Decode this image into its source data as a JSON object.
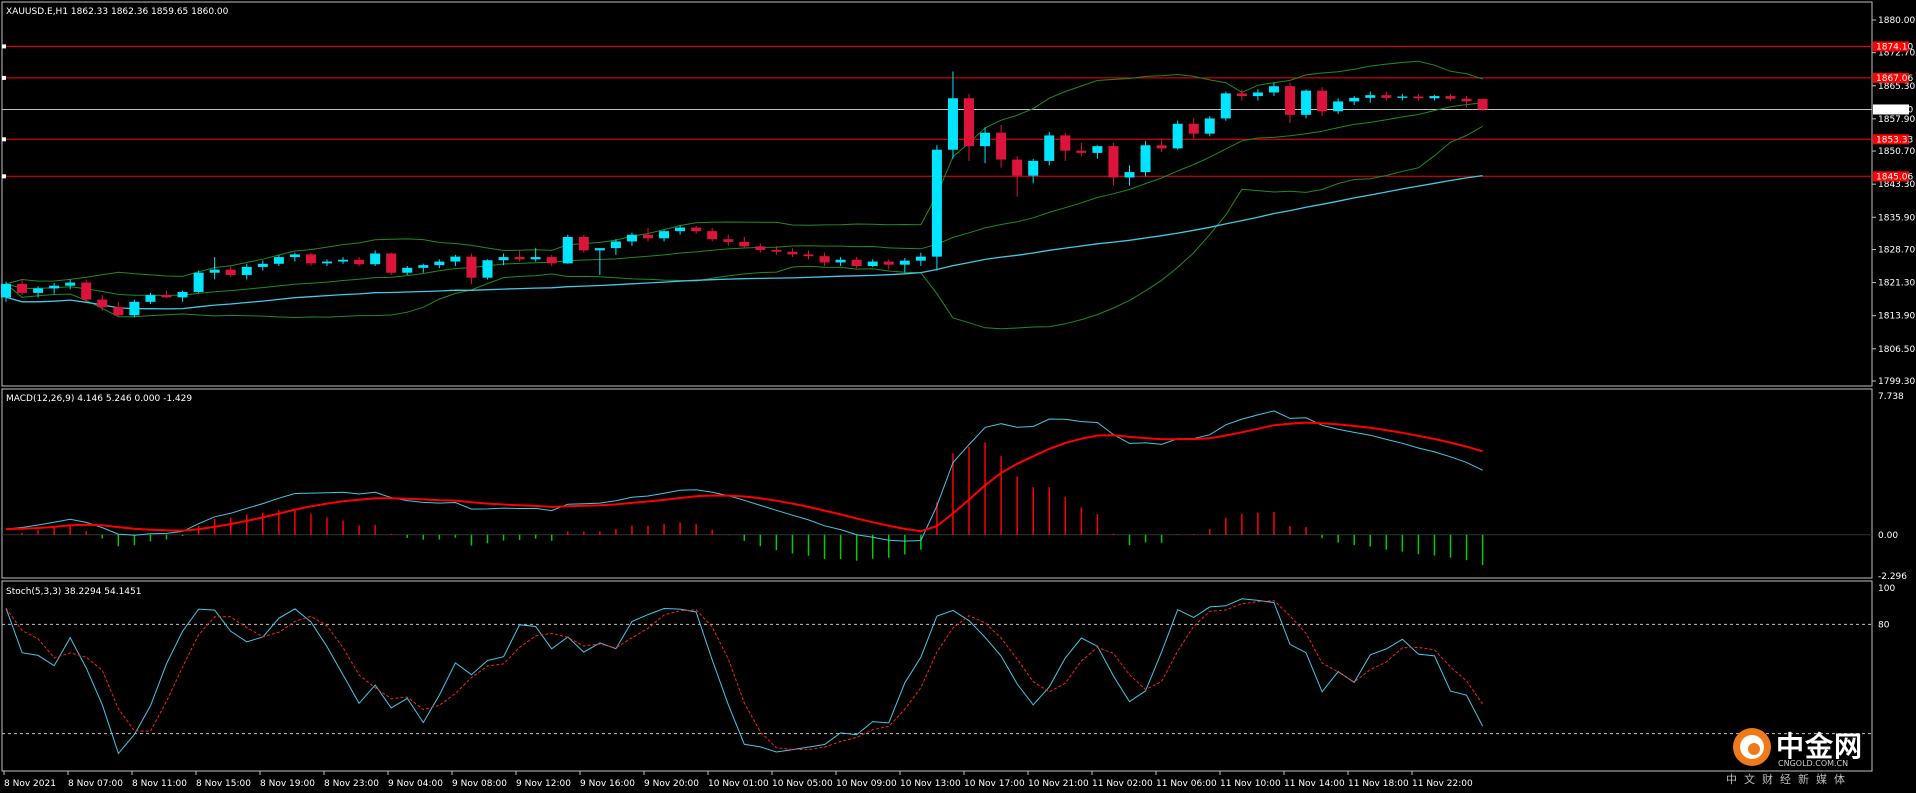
{
  "colors": {
    "background": "#000000",
    "frame": "#c0c0c0",
    "bull_candle": "#00e5ff",
    "bear_candle": "#dc143c",
    "hline": "#ff0000",
    "bid_line": "#c0c0c0",
    "bollinger": "#1e8c1e",
    "moving_average": "#41c8e6",
    "macd_line": "#41c8e6",
    "signal_line": "#ff0000",
    "hist_pos": "#ff0000",
    "hist_neg": "#00cc00",
    "stoch_main": "#41c8e6",
    "stoch_signal": "#ff2020",
    "level_line": "#c0c0c0"
  },
  "main_panel": {
    "info": "XAUUSD.E,H1  1862.33 1862.36 1859.65 1860.00"
  },
  "macd_panel": {
    "info": "MACD(12,26,9) 4.146 5.246 0.000 -1.429"
  },
  "stoch_panel": {
    "info": "Stoch(5,3,3) 38.2294 54.1451"
  },
  "watermark": {
    "name": "中金网",
    "domain": "CNGOLD.COM.CN",
    "tagline": "中文财经新媒体"
  },
  "chart_data": [
    {
      "type": "candlestick",
      "title": "XAUUSD.E,H1",
      "y_ticks": [
        "1880.00",
        "1872.70",
        "1865.30",
        "1857.90",
        "1850.70",
        "1843.30",
        "1835.90",
        "1828.70",
        "1821.30",
        "1813.90",
        "1806.50",
        "1799.30"
      ],
      "ylim": [
        1799.3,
        1880.0
      ],
      "price_badges": [
        {
          "label": "1874.10",
          "value": 1874.1
        },
        {
          "label": "1867.06",
          "value": 1867.06
        },
        {
          "label": "1853.33",
          "value": 1853.33
        },
        {
          "label": "1845.06",
          "value": 1845.06
        }
      ],
      "bid": {
        "label": "1860.00",
        "value": 1860.0
      },
      "horizontal_lines": [
        1874.1,
        1867.06,
        1853.33,
        1845.06
      ],
      "ohlc": [
        [
          1818.0,
          1821.5,
          1817.0,
          1821.0
        ],
        [
          1821.0,
          1822.0,
          1818.5,
          1819.0
        ],
        [
          1819.0,
          1820.5,
          1818.0,
          1820.0
        ],
        [
          1820.0,
          1821.2,
          1818.8,
          1820.6
        ],
        [
          1820.6,
          1822.0,
          1819.8,
          1821.3
        ],
        [
          1821.3,
          1822.0,
          1817.0,
          1817.5
        ],
        [
          1817.5,
          1818.5,
          1815.0,
          1815.8
        ],
        [
          1815.8,
          1817.0,
          1813.5,
          1814.0
        ],
        [
          1814.0,
          1817.5,
          1813.5,
          1817.0
        ],
        [
          1817.0,
          1819.0,
          1816.5,
          1818.5
        ],
        [
          1818.5,
          1819.5,
          1817.8,
          1818.0
        ],
        [
          1818.0,
          1819.5,
          1817.0,
          1819.2
        ],
        [
          1819.2,
          1824.0,
          1819.0,
          1823.5
        ],
        [
          1823.5,
          1827.0,
          1822.0,
          1824.2
        ],
        [
          1824.2,
          1825.0,
          1822.5,
          1823.0
        ],
        [
          1823.0,
          1825.5,
          1822.0,
          1824.8
        ],
        [
          1824.8,
          1826.2,
          1824.0,
          1825.5
        ],
        [
          1825.5,
          1827.5,
          1825.0,
          1827.0
        ],
        [
          1827.0,
          1828.0,
          1826.0,
          1827.6
        ],
        [
          1827.6,
          1828.0,
          1825.0,
          1825.6
        ],
        [
          1825.6,
          1826.5,
          1825.0,
          1826.0
        ],
        [
          1826.0,
          1827.0,
          1825.5,
          1826.4
        ],
        [
          1826.4,
          1827.0,
          1825.0,
          1825.4
        ],
        [
          1825.4,
          1828.5,
          1825.0,
          1827.8
        ],
        [
          1827.8,
          1828.0,
          1823.0,
          1823.5
        ],
        [
          1823.5,
          1825.0,
          1823.0,
          1824.6
        ],
        [
          1824.6,
          1825.5,
          1823.5,
          1825.2
        ],
        [
          1825.2,
          1826.5,
          1824.5,
          1826.0
        ],
        [
          1826.0,
          1827.5,
          1825.0,
          1827.1
        ],
        [
          1827.1,
          1827.8,
          1821.0,
          1822.4
        ],
        [
          1822.4,
          1826.5,
          1822.0,
          1826.3
        ],
        [
          1826.3,
          1827.8,
          1825.2,
          1827.0
        ],
        [
          1827.0,
          1828.5,
          1826.0,
          1826.5
        ],
        [
          1826.5,
          1829.0,
          1826.0,
          1827.0
        ],
        [
          1827.0,
          1827.5,
          1825.0,
          1825.6
        ],
        [
          1825.6,
          1832.0,
          1825.5,
          1831.5
        ],
        [
          1831.5,
          1832.0,
          1828.0,
          1828.5
        ],
        [
          1828.5,
          1829.0,
          1823.0,
          1829.0
        ],
        [
          1829.0,
          1831.0,
          1827.5,
          1830.5
        ],
        [
          1830.5,
          1832.5,
          1829.5,
          1832.0
        ],
        [
          1832.0,
          1833.5,
          1830.5,
          1831.2
        ],
        [
          1831.2,
          1833.0,
          1830.5,
          1832.8
        ],
        [
          1832.8,
          1834.0,
          1832.0,
          1833.6
        ],
        [
          1833.6,
          1834.0,
          1832.2,
          1832.8
        ],
        [
          1832.8,
          1833.5,
          1830.5,
          1831.0
        ],
        [
          1831.0,
          1832.0,
          1829.5,
          1830.4
        ],
        [
          1830.4,
          1831.5,
          1829.0,
          1829.4
        ],
        [
          1829.4,
          1830.0,
          1828.0,
          1828.6
        ],
        [
          1828.6,
          1829.5,
          1827.5,
          1828.2
        ],
        [
          1828.2,
          1829.0,
          1827.0,
          1827.6
        ],
        [
          1827.6,
          1828.5,
          1826.5,
          1827.2
        ],
        [
          1827.2,
          1828.0,
          1825.0,
          1825.8
        ],
        [
          1825.8,
          1827.0,
          1825.0,
          1826.4
        ],
        [
          1826.4,
          1827.0,
          1824.5,
          1825.0
        ],
        [
          1825.0,
          1826.5,
          1824.8,
          1826.0
        ],
        [
          1826.0,
          1826.5,
          1824.2,
          1825.3
        ],
        [
          1825.3,
          1826.8,
          1823.5,
          1826.2
        ],
        [
          1826.2,
          1828.0,
          1825.0,
          1827.1
        ],
        [
          1827.1,
          1852.0,
          1824.0,
          1851.0
        ],
        [
          1851.0,
          1868.5,
          1849.0,
          1862.5
        ],
        [
          1862.5,
          1863.5,
          1848.5,
          1851.8
        ],
        [
          1851.8,
          1856.0,
          1848.0,
          1854.8
        ],
        [
          1854.8,
          1856.5,
          1847.0,
          1848.8
        ],
        [
          1848.8,
          1849.5,
          1840.5,
          1845.2
        ],
        [
          1845.2,
          1849.0,
          1843.5,
          1848.5
        ],
        [
          1848.5,
          1855.0,
          1847.5,
          1854.2
        ],
        [
          1854.2,
          1854.8,
          1848.5,
          1850.8
        ],
        [
          1850.8,
          1852.5,
          1849.5,
          1850.3
        ],
        [
          1850.3,
          1852.0,
          1849.0,
          1851.8
        ],
        [
          1851.8,
          1852.5,
          1843.0,
          1844.8
        ],
        [
          1844.8,
          1847.5,
          1843.0,
          1846.0
        ],
        [
          1846.0,
          1853.0,
          1845.0,
          1852.0
        ],
        [
          1852.0,
          1853.5,
          1850.5,
          1851.3
        ],
        [
          1851.3,
          1857.5,
          1851.0,
          1856.8
        ],
        [
          1856.8,
          1858.0,
          1853.5,
          1854.6
        ],
        [
          1854.6,
          1858.5,
          1854.0,
          1858.0
        ],
        [
          1858.0,
          1864.0,
          1857.5,
          1863.6
        ],
        [
          1863.6,
          1864.5,
          1862.0,
          1863.0
        ],
        [
          1863.0,
          1864.5,
          1862.0,
          1863.8
        ],
        [
          1863.8,
          1866.0,
          1863.0,
          1865.2
        ],
        [
          1865.2,
          1866.0,
          1857.0,
          1858.8
        ],
        [
          1858.8,
          1864.5,
          1858.0,
          1864.2
        ],
        [
          1864.2,
          1865.0,
          1858.5,
          1859.6
        ],
        [
          1859.6,
          1862.5,
          1859.0,
          1861.8
        ],
        [
          1861.8,
          1863.0,
          1861.0,
          1862.6
        ],
        [
          1862.6,
          1864.0,
          1861.5,
          1863.2
        ],
        [
          1863.2,
          1864.0,
          1862.0,
          1862.6
        ],
        [
          1862.6,
          1863.5,
          1862.0,
          1862.9
        ],
        [
          1862.9,
          1863.5,
          1862.0,
          1862.5
        ],
        [
          1862.5,
          1863.3,
          1862.0,
          1863.0
        ],
        [
          1863.0,
          1863.5,
          1862.0,
          1862.4
        ],
        [
          1862.4,
          1863.0,
          1860.5,
          1861.8
        ],
        [
          1862.33,
          1862.36,
          1859.65,
          1860.0
        ]
      ]
    },
    {
      "type": "macd",
      "title": "MACD(12,26,9)",
      "values": {
        "macd": 4.146,
        "signal": 5.246,
        "zero": 0.0,
        "hist": -1.429
      },
      "y_ticks": [
        "7.738",
        "0.00",
        "-2.296"
      ],
      "ylim": [
        -2.296,
        7.738
      ]
    },
    {
      "type": "stochastic",
      "title": "Stoch(5,3,3)",
      "values": {
        "main": 38.2294,
        "signal": 54.1451
      },
      "y_ticks": [
        "100",
        "80"
      ],
      "levels": [
        80,
        20
      ],
      "ylim": [
        0,
        100
      ]
    }
  ],
  "time_labels": [
    "8 Nov 2021",
    "8 Nov 07:00",
    "8 Nov 11:00",
    "8 Nov 15:00",
    "8 Nov 19:00",
    "8 Nov 23:00",
    "9 Nov 04:00",
    "9 Nov 08:00",
    "9 Nov 12:00",
    "9 Nov 16:00",
    "9 Nov 20:00",
    "10 Nov 01:00",
    "10 Nov 05:00",
    "10 Nov 09:00",
    "10 Nov 13:00",
    "10 Nov 17:00",
    "10 Nov 21:00",
    "11 Nov 02:00",
    "11 Nov 06:00",
    "11 Nov 10:00",
    "11 Nov 14:00",
    "11 Nov 18:00",
    "11 Nov 22:00"
  ]
}
